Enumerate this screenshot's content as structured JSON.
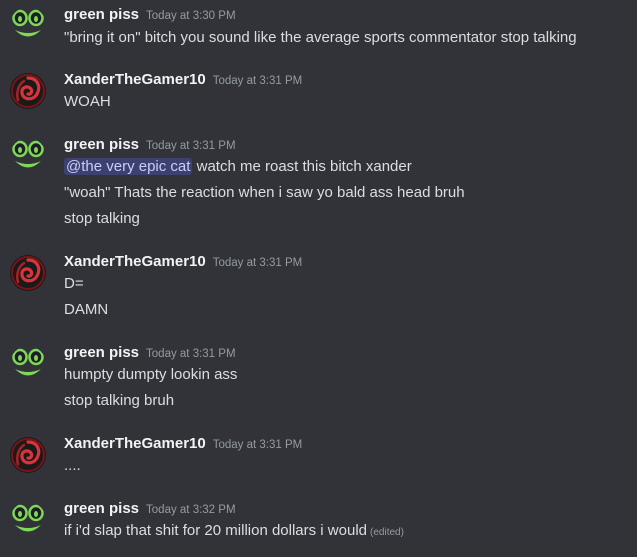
{
  "colors": {
    "background": "#313338",
    "username": "#f2f3f5",
    "text": "#dbdee1",
    "timestamp": "#949ba4",
    "mention_bg": "#3c4270",
    "mention_text": "#c9cdfb"
  },
  "messages": [
    {
      "author": "green piss",
      "avatar": "green-frog-avatar",
      "timestamp": "Today at 3:30 PM",
      "lines": [
        "\"bring it on\" bitch you sound like the average sports commentator stop talking"
      ]
    },
    {
      "author": "XanderTheGamer10",
      "avatar": "red-swirl-avatar",
      "timestamp": "Today at 3:31 PM",
      "lines": [
        "WOAH"
      ]
    },
    {
      "author": "green piss",
      "avatar": "green-frog-avatar",
      "timestamp": "Today at 3:31 PM",
      "mention": "@the very epic cat",
      "lines": [
        " watch me roast this bitch xander",
        "\"woah\" Thats the reaction when i saw yo bald ass head bruh",
        "stop talking"
      ]
    },
    {
      "author": "XanderTheGamer10",
      "avatar": "red-swirl-avatar",
      "timestamp": "Today at 3:31 PM",
      "lines": [
        "D=",
        "DAMN"
      ]
    },
    {
      "author": "green piss",
      "avatar": "green-frog-avatar",
      "timestamp": "Today at 3:31 PM",
      "lines": [
        "humpty dumpty lookin ass",
        "stop talking bruh"
      ]
    },
    {
      "author": "XanderTheGamer10",
      "avatar": "red-swirl-avatar",
      "timestamp": "Today at 3:31 PM",
      "lines": [
        "...."
      ]
    },
    {
      "author": "green piss",
      "avatar": "green-frog-avatar",
      "timestamp": "Today at 3:32 PM",
      "lines": [
        "if i'd slap that shit for 20 million dollars i would"
      ],
      "edited": "(edited)"
    }
  ]
}
